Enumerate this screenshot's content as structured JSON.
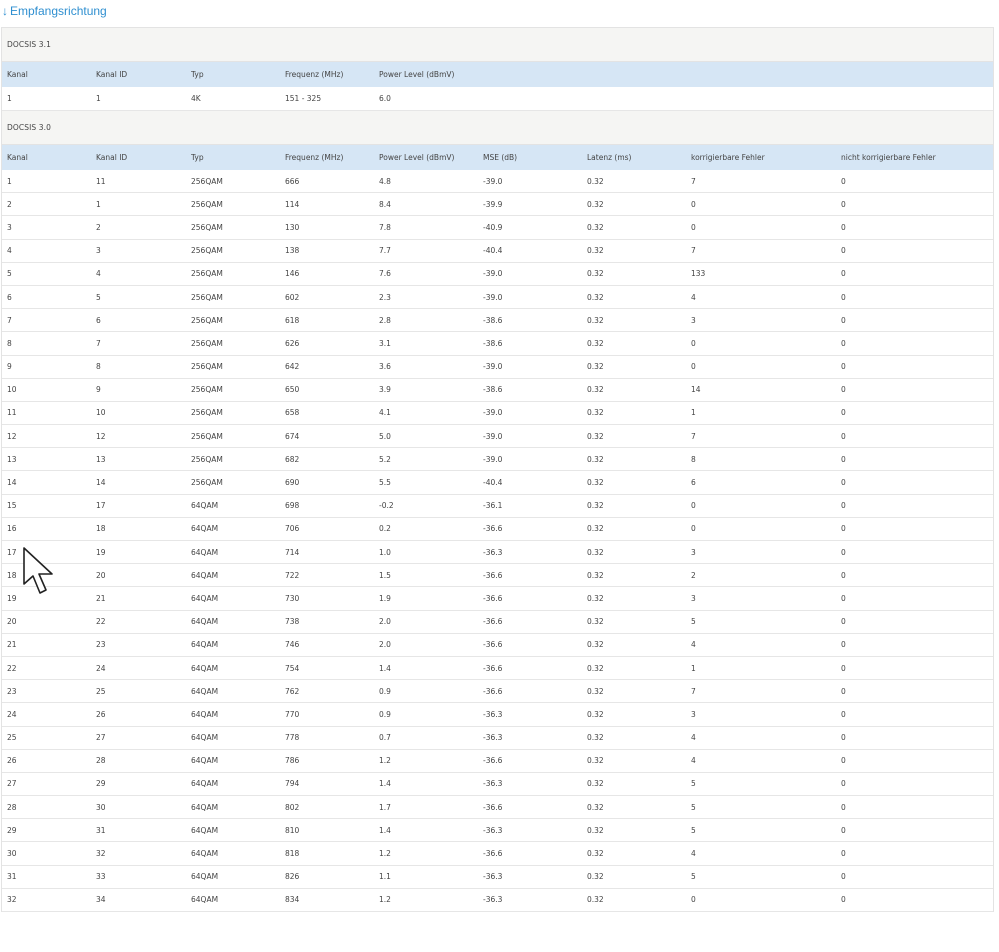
{
  "section": {
    "arrow": "↓",
    "title": "Empfangsrichtung"
  },
  "docsis31": {
    "group_label": "DOCSIS 3.1",
    "headers": [
      "Kanal",
      "Kanal ID",
      "Typ",
      "Frequenz (MHz)",
      "Power Level (dBmV)"
    ],
    "rows": [
      [
        "1",
        "1",
        "4K",
        "151 - 325",
        "6.0"
      ]
    ]
  },
  "docsis30": {
    "group_label": "DOCSIS 3.0",
    "headers": [
      "Kanal",
      "Kanal ID",
      "Typ",
      "Frequenz (MHz)",
      "Power Level (dBmV)",
      "MSE (dB)",
      "Latenz (ms)",
      "korrigierbare Fehler",
      "nicht korrigierbare Fehler"
    ],
    "rows": [
      [
        "1",
        "11",
        "256QAM",
        "666",
        "4.8",
        "-39.0",
        "0.32",
        "7",
        "0"
      ],
      [
        "2",
        "1",
        "256QAM",
        "114",
        "8.4",
        "-39.9",
        "0.32",
        "0",
        "0"
      ],
      [
        "3",
        "2",
        "256QAM",
        "130",
        "7.8",
        "-40.9",
        "0.32",
        "0",
        "0"
      ],
      [
        "4",
        "3",
        "256QAM",
        "138",
        "7.7",
        "-40.4",
        "0.32",
        "7",
        "0"
      ],
      [
        "5",
        "4",
        "256QAM",
        "146",
        "7.6",
        "-39.0",
        "0.32",
        "133",
        "0"
      ],
      [
        "6",
        "5",
        "256QAM",
        "602",
        "2.3",
        "-39.0",
        "0.32",
        "4",
        "0"
      ],
      [
        "7",
        "6",
        "256QAM",
        "618",
        "2.8",
        "-38.6",
        "0.32",
        "3",
        "0"
      ],
      [
        "8",
        "7",
        "256QAM",
        "626",
        "3.1",
        "-38.6",
        "0.32",
        "0",
        "0"
      ],
      [
        "9",
        "8",
        "256QAM",
        "642",
        "3.6",
        "-39.0",
        "0.32",
        "0",
        "0"
      ],
      [
        "10",
        "9",
        "256QAM",
        "650",
        "3.9",
        "-38.6",
        "0.32",
        "14",
        "0"
      ],
      [
        "11",
        "10",
        "256QAM",
        "658",
        "4.1",
        "-39.0",
        "0.32",
        "1",
        "0"
      ],
      [
        "12",
        "12",
        "256QAM",
        "674",
        "5.0",
        "-39.0",
        "0.32",
        "7",
        "0"
      ],
      [
        "13",
        "13",
        "256QAM",
        "682",
        "5.2",
        "-39.0",
        "0.32",
        "8",
        "0"
      ],
      [
        "14",
        "14",
        "256QAM",
        "690",
        "5.5",
        "-40.4",
        "0.32",
        "6",
        "0"
      ],
      [
        "15",
        "17",
        "64QAM",
        "698",
        "-0.2",
        "-36.1",
        "0.32",
        "0",
        "0"
      ],
      [
        "16",
        "18",
        "64QAM",
        "706",
        "0.2",
        "-36.6",
        "0.32",
        "0",
        "0"
      ],
      [
        "17",
        "19",
        "64QAM",
        "714",
        "1.0",
        "-36.3",
        "0.32",
        "3",
        "0"
      ],
      [
        "18",
        "20",
        "64QAM",
        "722",
        "1.5",
        "-36.6",
        "0.32",
        "2",
        "0"
      ],
      [
        "19",
        "21",
        "64QAM",
        "730",
        "1.9",
        "-36.6",
        "0.32",
        "3",
        "0"
      ],
      [
        "20",
        "22",
        "64QAM",
        "738",
        "2.0",
        "-36.6",
        "0.32",
        "5",
        "0"
      ],
      [
        "21",
        "23",
        "64QAM",
        "746",
        "2.0",
        "-36.6",
        "0.32",
        "4",
        "0"
      ],
      [
        "22",
        "24",
        "64QAM",
        "754",
        "1.4",
        "-36.6",
        "0.32",
        "1",
        "0"
      ],
      [
        "23",
        "25",
        "64QAM",
        "762",
        "0.9",
        "-36.6",
        "0.32",
        "7",
        "0"
      ],
      [
        "24",
        "26",
        "64QAM",
        "770",
        "0.9",
        "-36.3",
        "0.32",
        "3",
        "0"
      ],
      [
        "25",
        "27",
        "64QAM",
        "778",
        "0.7",
        "-36.3",
        "0.32",
        "4",
        "0"
      ],
      [
        "26",
        "28",
        "64QAM",
        "786",
        "1.2",
        "-36.6",
        "0.32",
        "4",
        "0"
      ],
      [
        "27",
        "29",
        "64QAM",
        "794",
        "1.4",
        "-36.3",
        "0.32",
        "5",
        "0"
      ],
      [
        "28",
        "30",
        "64QAM",
        "802",
        "1.7",
        "-36.6",
        "0.32",
        "5",
        "0"
      ],
      [
        "29",
        "31",
        "64QAM",
        "810",
        "1.4",
        "-36.3",
        "0.32",
        "5",
        "0"
      ],
      [
        "30",
        "32",
        "64QAM",
        "818",
        "1.2",
        "-36.6",
        "0.32",
        "4",
        "0"
      ],
      [
        "31",
        "33",
        "64QAM",
        "826",
        "1.1",
        "-36.3",
        "0.32",
        "5",
        "0"
      ],
      [
        "32",
        "34",
        "64QAM",
        "834",
        "1.2",
        "-36.3",
        "0.32",
        "0",
        "0"
      ]
    ]
  },
  "colors": {
    "link": "#2f8fd0",
    "header_bg": "#d6e6f5",
    "group_bg": "#f5f5f3"
  },
  "icons": {
    "cursor": "mouse-pointer-icon"
  }
}
